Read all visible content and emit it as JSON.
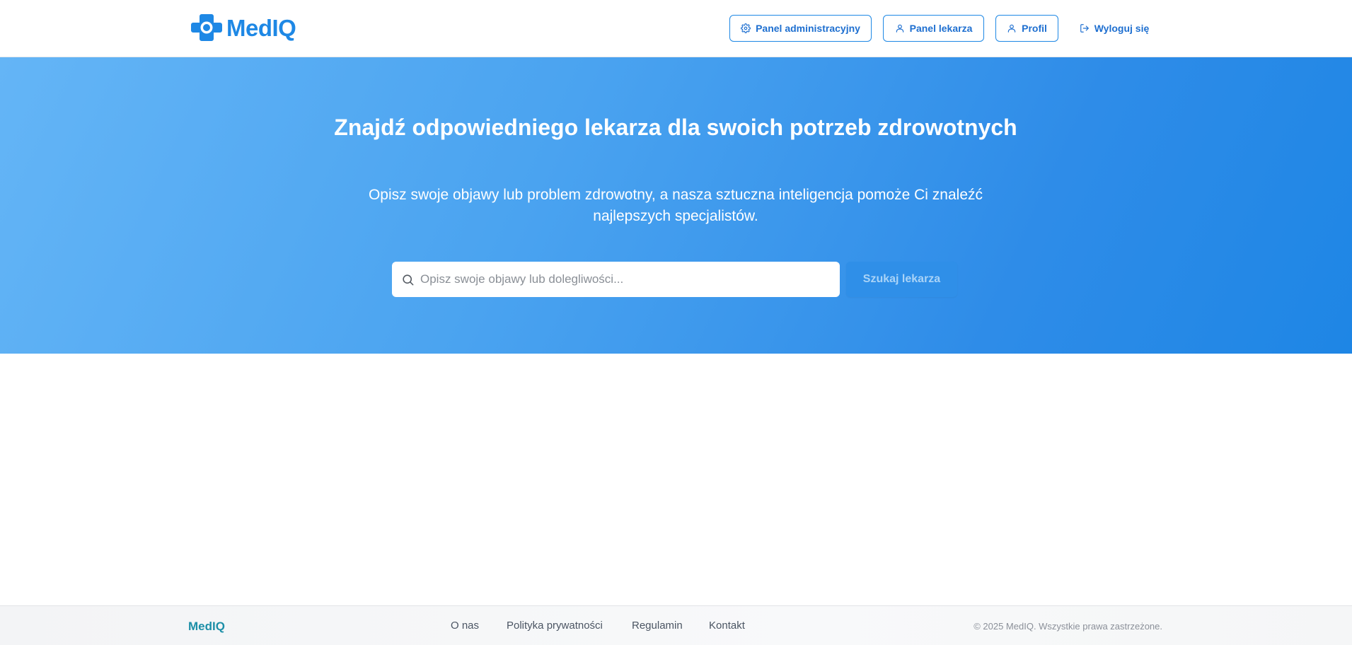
{
  "colors": {
    "brand": "#1e88e5",
    "hero_gradient_start": "#64b5f6",
    "hero_gradient_end": "#1e86e5",
    "footer_logo": "#1d8fa8"
  },
  "header": {
    "logo_text": "MedIQ",
    "logo_icon": "medical-cross-icon",
    "nav": {
      "admin_label": "Panel administracyjny",
      "admin_icon": "gear-icon",
      "doctor_label": "Panel lekarza",
      "doctor_icon": "user-icon",
      "profile_label": "Profil",
      "profile_icon": "user-icon",
      "logout_label": "Wyloguj się",
      "logout_icon": "logout-icon"
    }
  },
  "hero": {
    "title": "Znajdź odpowiedniego lekarza dla swoich potrzeb zdrowotnych",
    "subtitle": "Opisz swoje objawy lub problem zdrowotny, a nasza sztuczna inteligencja pomoże Ci znaleźć najlepszych specjalistów.",
    "search": {
      "icon": "search-icon",
      "placeholder": "Opisz swoje objawy lub dolegliwości...",
      "value": "",
      "button_label": "Szukaj lekarza"
    }
  },
  "footer": {
    "logo_text": "MedIQ",
    "links": [
      "O nas",
      "Polityka prywatności",
      "Regulamin",
      "Kontakt"
    ],
    "copyright": "© 2025 MedIQ. Wszystkie prawa zastrzeżone."
  }
}
